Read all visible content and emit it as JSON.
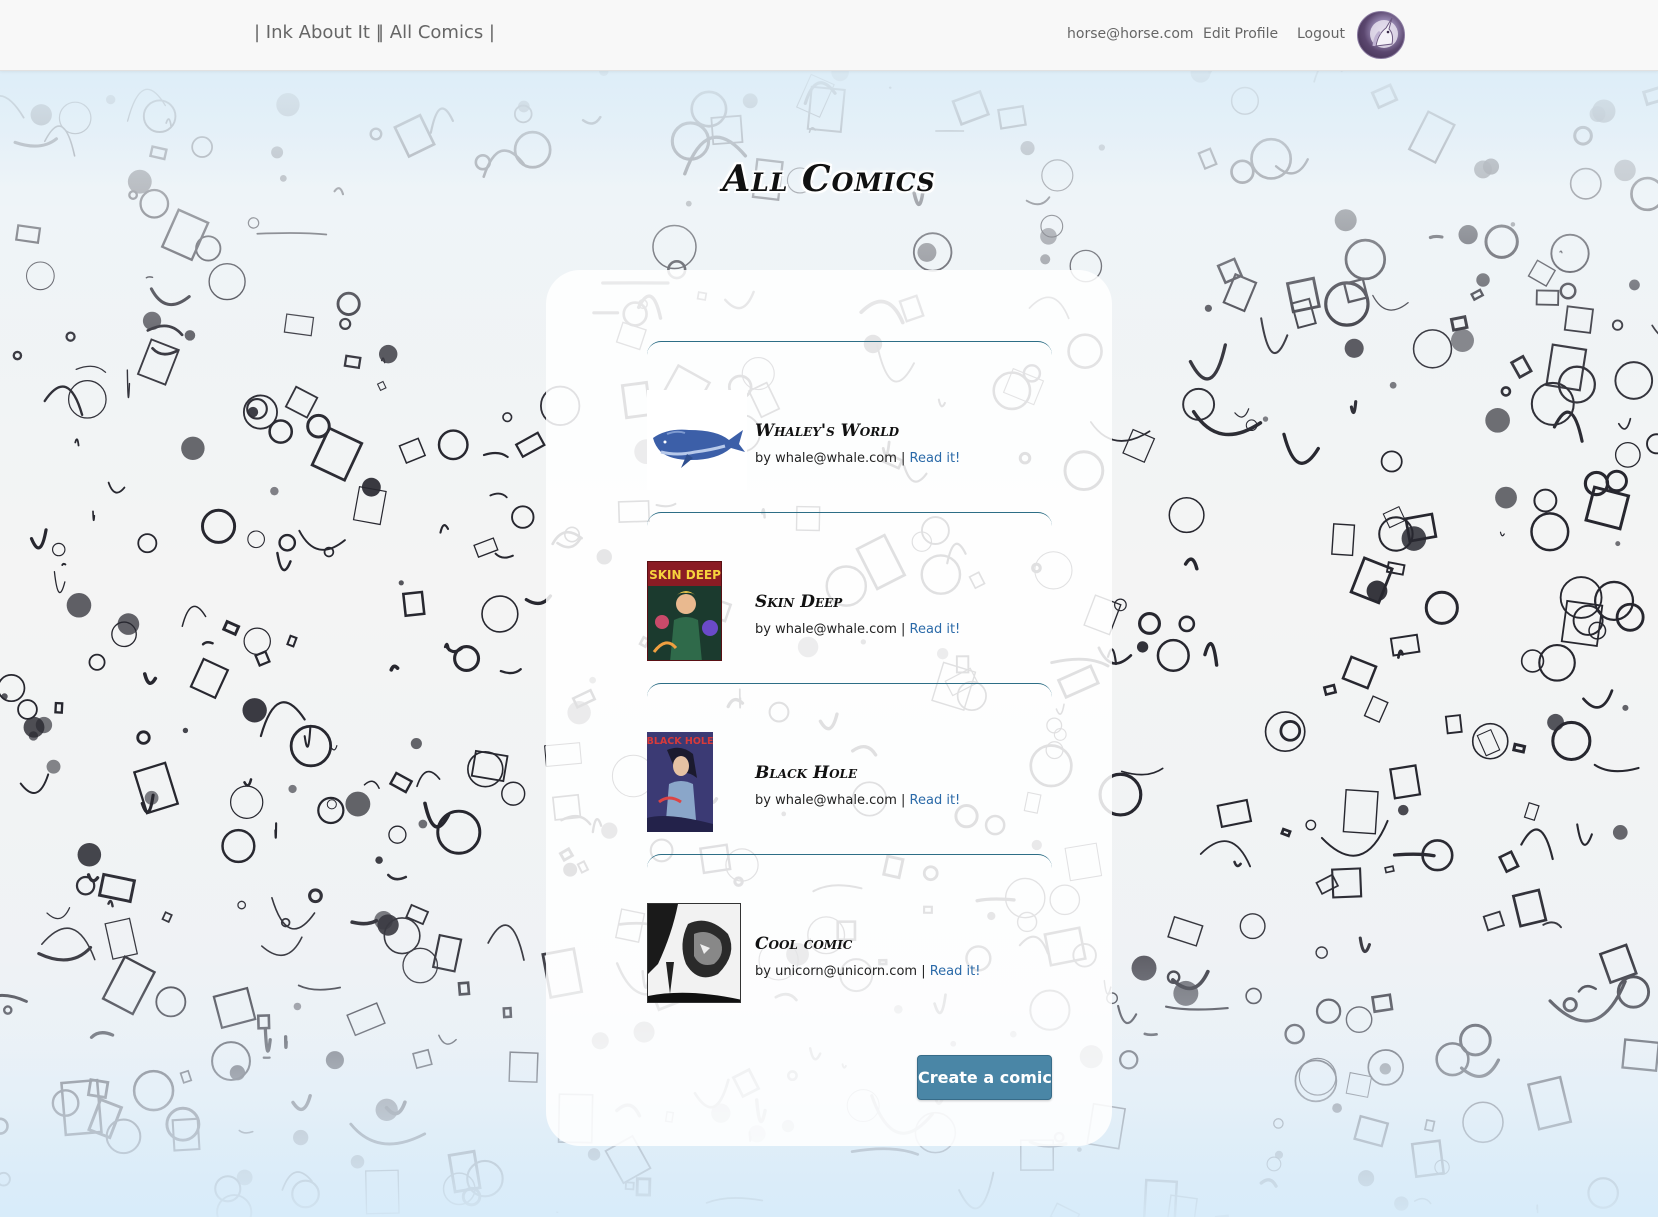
{
  "navbar": {
    "brand": "| Ink About It |",
    "all_comics_link": "| All Comics |",
    "user_email": "horse@horse.com",
    "edit_profile": "Edit Profile",
    "logout": "Logout"
  },
  "page": {
    "title": "All Comics"
  },
  "comics": [
    {
      "title": "Whaley's World",
      "author": "whale@whale.com",
      "read_label": "Read it!"
    },
    {
      "title": "Skin Deep",
      "author": "whale@whale.com",
      "read_label": "Read it!"
    },
    {
      "title": "Black Hole",
      "author": "whale@whale.com",
      "read_label": "Read it!"
    },
    {
      "title": "Cool comic",
      "author": "unicorn@unicorn.com",
      "read_label": "Read it!"
    }
  ],
  "byline_prefix": "by ",
  "separator": " | ",
  "cover_texts": {
    "skin_deep": "SKIN DEEP",
    "black_hole": "BLACK HOLE"
  },
  "actions": {
    "create_label": "Create a comic"
  },
  "colors": {
    "navbar_bg": "#f8f8f8",
    "button_bg": "#4a86a6",
    "divider": "#2d6e86",
    "link": "#2b6aa8"
  }
}
